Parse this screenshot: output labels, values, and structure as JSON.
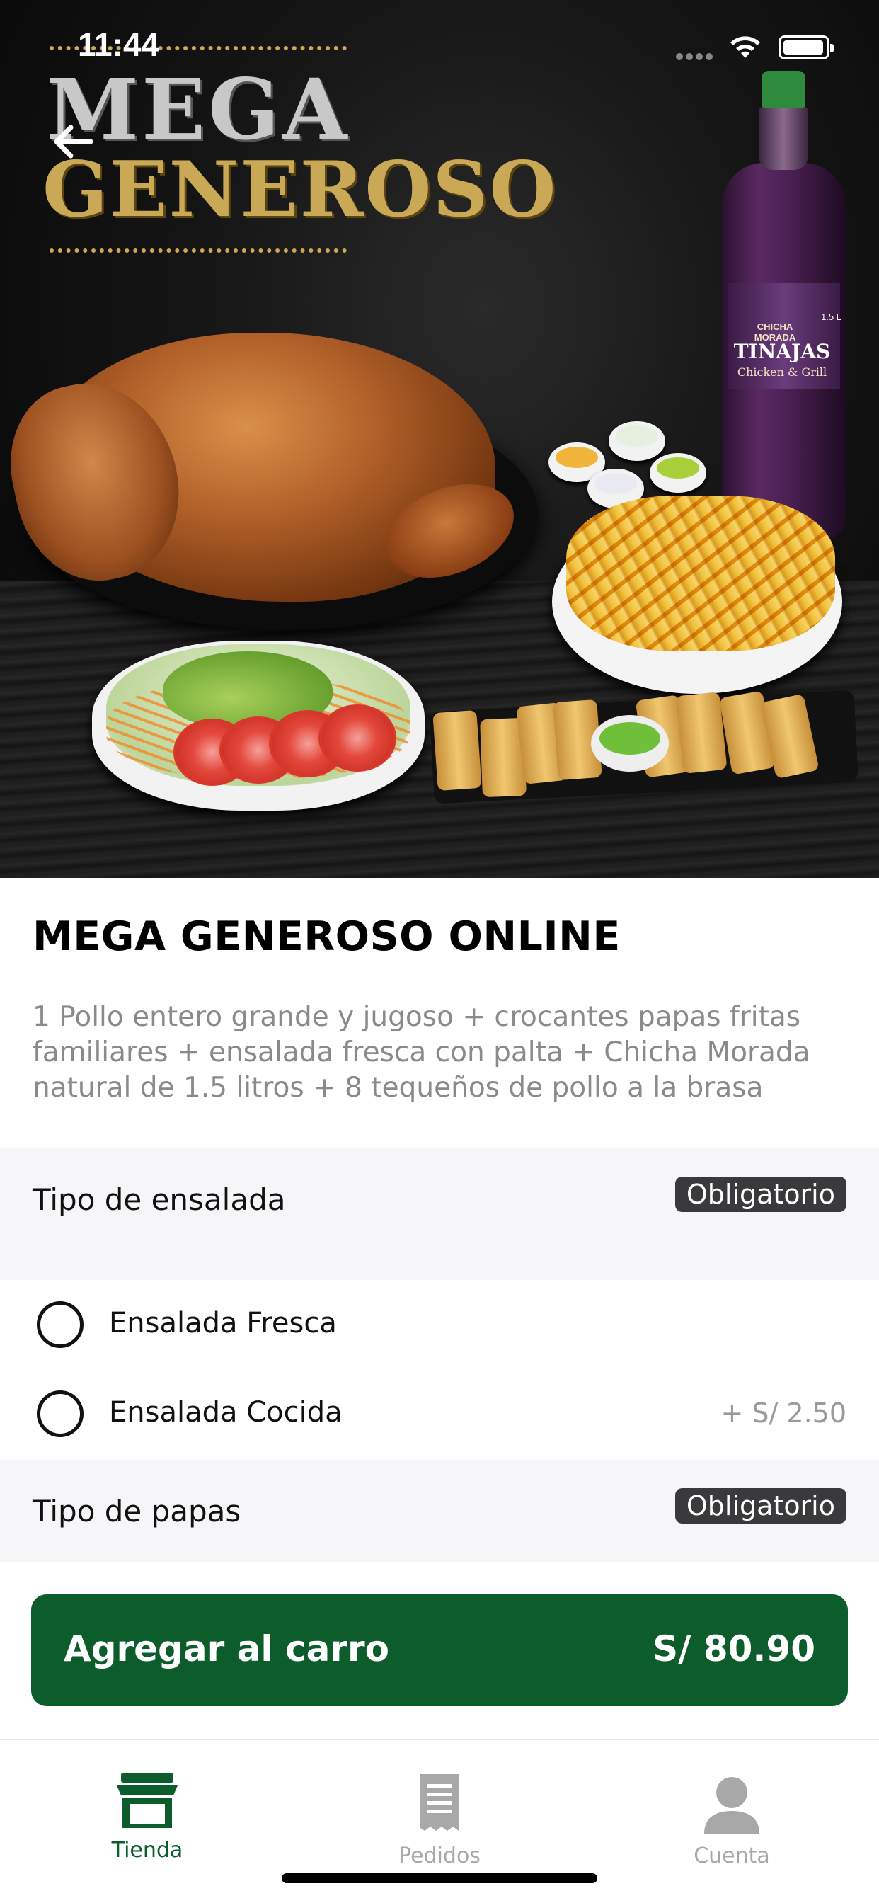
{
  "status_bar": {
    "time": "11:44"
  },
  "hero": {
    "promo_line1": "MEGA",
    "promo_line2": "GENEROSO",
    "bottle_label_top": "CHICHA MORADA",
    "bottle_brand": "TINAJAS",
    "bottle_sub": "Chicken & Grill",
    "bottle_volume": "1.5 L"
  },
  "product": {
    "title": "MEGA GENEROSO ONLINE",
    "description": "1 Pollo entero grande y jugoso + crocantes papas fritas familiares + ensalada fresca con palta + Chicha Morada natural de 1.5 litros + 8 tequeños de pollo a la brasa"
  },
  "groups": [
    {
      "title": "Tipo de ensalada",
      "badge": "Obligatorio",
      "options": [
        {
          "label": "Ensalada Fresca",
          "price": ""
        },
        {
          "label": "Ensalada Cocida",
          "price": "+ S/ 2.50"
        }
      ]
    },
    {
      "title": "Tipo de papas",
      "badge": "Obligatorio",
      "options": []
    }
  ],
  "cart": {
    "label": "Agregar al carro",
    "price": "S/ 80.90"
  },
  "tabs": [
    {
      "label": "Tienda",
      "icon": "store-icon",
      "active": true
    },
    {
      "label": "Pedidos",
      "icon": "receipt-icon",
      "active": false
    },
    {
      "label": "Cuenta",
      "icon": "account-icon",
      "active": false
    }
  ],
  "colors": {
    "primary": "#0c5c2c",
    "active_tab": "#0c5c2c",
    "inactive_tab": "#a8a8a8",
    "badge_bg": "#3a3a3c",
    "section_bg": "#f6f6f8",
    "promo_gold": "#c9a856"
  }
}
